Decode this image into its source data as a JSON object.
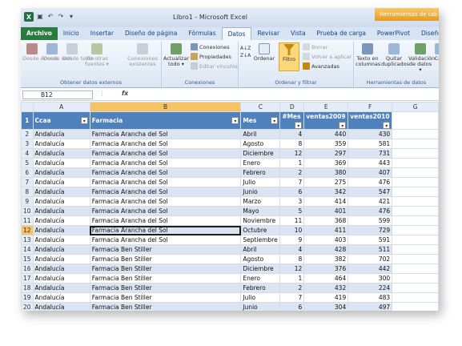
{
  "window": {
    "title": "Libro1 - Microsoft Excel",
    "context_tab_title": "Herramientas de tab"
  },
  "qat": {
    "logo": "X",
    "save": "save-icon",
    "undo": "undo-icon",
    "redo": "redo-icon"
  },
  "tabs": [
    {
      "label": "Archivo"
    },
    {
      "label": "Inicio"
    },
    {
      "label": "Insertar"
    },
    {
      "label": "Diseño de página"
    },
    {
      "label": "Fórmulas"
    },
    {
      "label": "Datos"
    },
    {
      "label": "Revisar"
    },
    {
      "label": "Vista"
    },
    {
      "label": "Prueba de carga"
    },
    {
      "label": "PowerPivot"
    },
    {
      "label": "Diseño"
    }
  ],
  "ribbon": {
    "group1": {
      "label": "Obtener datos externos",
      "btns": [
        "Desde Access",
        "Desde web",
        "Desde texto",
        "De otras fuentes ▾",
        "Conexiones existentes"
      ]
    },
    "group2": {
      "label": "Conexiones",
      "refresh": "Actualizar todo ▾",
      "items": [
        "Conexiones",
        "Propiedades",
        "Editar vínculos"
      ]
    },
    "group3": {
      "label": "Ordenar y filtrar",
      "sort": "Ordenar",
      "filter": "Filtro",
      "items": [
        "Borrar",
        "Volver a aplicar",
        "Avanzadas"
      ]
    },
    "group4": {
      "label": "Herramientas de datos",
      "btns": [
        "Texto en columnas",
        "Quitar duplicados",
        "Validación de datos ▾",
        "Co"
      ]
    }
  },
  "formula_bar": {
    "cell_ref": "B12",
    "fx": "fx",
    "dots": "⋮",
    "value": ""
  },
  "columns": [
    "A",
    "B",
    "C",
    "D",
    "E",
    "F",
    "G"
  ],
  "header_row": [
    "Ccaa",
    "Farmacia",
    "Mes",
    "#Mes",
    "ventas2009",
    "ventas2010"
  ],
  "rows": [
    [
      "Andalucía",
      "Farmacia Arancha del Sol",
      "Abril",
      "4",
      "440",
      "430"
    ],
    [
      "Andalucía",
      "Farmacia Arancha del Sol",
      "Agosto",
      "8",
      "359",
      "581"
    ],
    [
      "Andalucía",
      "Farmacia Arancha del Sol",
      "Diciembre",
      "12",
      "297",
      "731"
    ],
    [
      "Andalucía",
      "Farmacia Arancha del Sol",
      "Enero",
      "1",
      "369",
      "443"
    ],
    [
      "Andalucía",
      "Farmacia Arancha del Sol",
      "Febrero",
      "2",
      "380",
      "407"
    ],
    [
      "Andalucía",
      "Farmacia Arancha del Sol",
      "Julio",
      "7",
      "275",
      "476"
    ],
    [
      "Andalucía",
      "Farmacia Arancha del Sol",
      "Junio",
      "6",
      "342",
      "547"
    ],
    [
      "Andalucía",
      "Farmacia Arancha del Sol",
      "Marzo",
      "3",
      "414",
      "421"
    ],
    [
      "Andalucía",
      "Farmacia Arancha del Sol",
      "Mayo",
      "5",
      "401",
      "476"
    ],
    [
      "Andalucía",
      "Farmacia Arancha del Sol",
      "Noviembre",
      "11",
      "368",
      "599"
    ],
    [
      "Andalucía",
      "Farmacia Arancha del Sol",
      "Octubre",
      "10",
      "411",
      "729"
    ],
    [
      "Andalucía",
      "Farmacia Arancha del Sol",
      "Septiembre",
      "9",
      "403",
      "591"
    ],
    [
      "Andalucía",
      "Farmacia Ben Stiller",
      "Abril",
      "4",
      "428",
      "511"
    ],
    [
      "Andalucía",
      "Farmacia Ben Stiller",
      "Agosto",
      "8",
      "382",
      "702"
    ],
    [
      "Andalucía",
      "Farmacia Ben Stiller",
      "Diciembre",
      "12",
      "376",
      "442"
    ],
    [
      "Andalucía",
      "Farmacia Ben Stiller",
      "Enero",
      "1",
      "464",
      "300"
    ],
    [
      "Andalucía",
      "Farmacia Ben Stiller",
      "Febrero",
      "2",
      "432",
      "224"
    ],
    [
      "Andalucía",
      "Farmacia Ben Stiller",
      "Julio",
      "7",
      "419",
      "483"
    ],
    [
      "Andalucía",
      "Farmacia Ben Stiller",
      "Junio",
      "6",
      "304",
      "497"
    ],
    [
      "Andalucía",
      "Farmacia Ben Stiller",
      "Marzo",
      "3",
      "392",
      "343"
    ],
    [
      "Andalucía",
      "Farmacia Ben Stiller",
      "Mayo",
      "5",
      "383",
      "395"
    ]
  ],
  "selected_cell": "B12",
  "colors": {
    "header_blue": "#4f81bd",
    "band": "#dbe5f1",
    "file_tab": "#2a7b3f",
    "context": "#e49b22"
  }
}
